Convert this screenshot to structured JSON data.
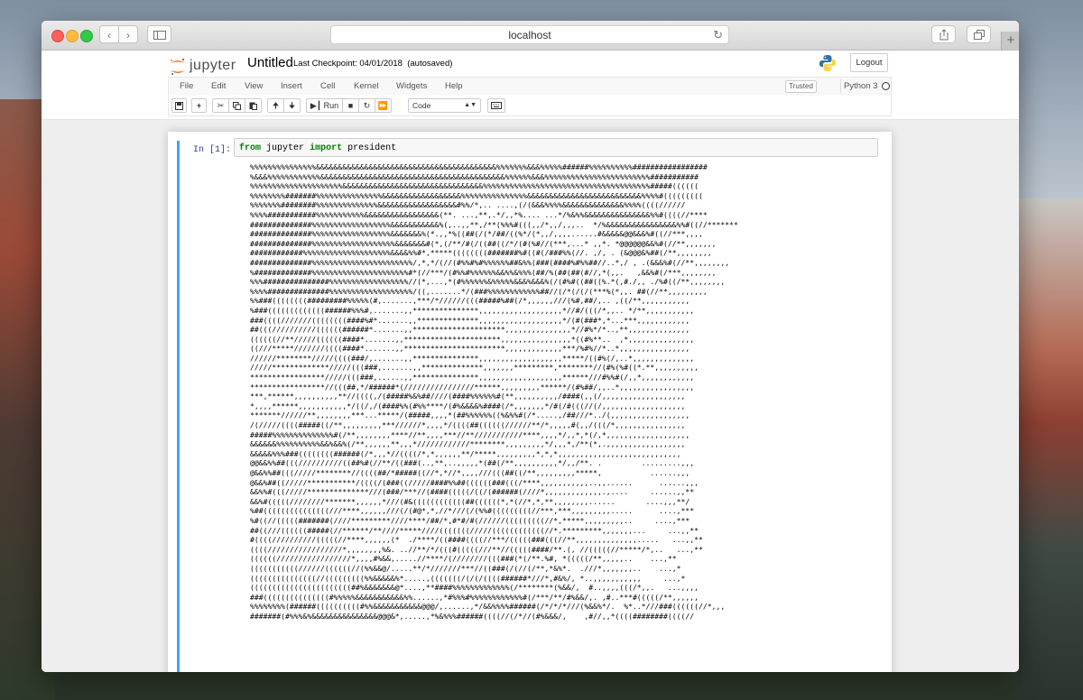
{
  "browser": {
    "url": "localhost"
  },
  "jupyter": {
    "logo_text": "jupyter",
    "notebook_title": "Untitled",
    "checkpoint": "Last Checkpoint: 04/01/2018",
    "autosave_status": "(autosaved)",
    "logout_label": "Logout",
    "menu": [
      "File",
      "Edit",
      "View",
      "Insert",
      "Cell",
      "Kernel",
      "Widgets",
      "Help"
    ],
    "trusted_label": "Trusted",
    "kernel_name": "Python 3",
    "toolbar": {
      "run_label": "Run",
      "cell_type": "Code"
    }
  },
  "cell": {
    "prompt": "In [1]:",
    "code": {
      "kw_from": "from",
      "module": "jupyter",
      "kw_import": "import",
      "name": "president"
    },
    "output_lines": [
      "%%%%%%%%%%%%%%%&&&&&&&&&&&&&&&&&&&&&&&&&&&&&&&&&&&&&&&&&%%%%%%%&&&%%%%%######%%%%%%%%%%#################",
      "%&&&%%%%%%%%%%%%&&&&&&&&&&&&&&&&&&&&&&&&&&&&&&&&&&&&&&&&&&%%%%%%&&&%%%%%%%%%%%%%%%%%%%%%%%%###########",
      "%%%%%%%%%%%%%%%%%%%%%&&&&&&&&&&&&&&&&&&&&&&&&&&&&&&&&%%%%%%%%%%%%%%%%%%%%%%%%%%%%%%%%%%%%%%#####((((((",
      "%%%%%%%%#######%%%%%%%%%%%%%%%&&&&&&&&&&&&&&&&&&%%%%%%%%%%%%%%%&&&&&&&&&&&&&&&&&&&&&&&&&&%%%%#(((((((((",
      "%%%%%%%########%%%%%%%%%%%%%%&&&&&&&&&&&&&&&&&&#%%/*,.. ....,(/(&&&%%%%&&&&&&&&&&&&&&%%%%((((//////",
      "%%%%###########%%%%%%%%%%%&&&&&&&&&&&&&&&&&(**. ...,**,.*/,,*%.... ...*/%&%%&&&&&&&&&&&&&&&%%#((((//****",
      "##############%%%%%%%%%%%%%%%%%%&&&&&&&&&&&%(,..,,**,/**(%%%#(((,,/*,,/,,,..  */%&&&&&&&&&&&&&&&&%%#((//*******",
      "##############%%%%%%%%%%%%%%%%%%&&&&&&&%(*.,,*%((##(/(*/##/((%*/(*,,/,,,,......#&&&&&@@&&&%#((//***,,,,",
      "##############%%%%%%%%%%%%%%%%%%%&&&&&&&#(*,(/**/#(/((##((/*/(#(%#//(***,...* ,,*. *@@@@@@&&%#(//**,,,,,,,",
      "############%%%%%%%%%%%%%%%%%%%%&&&&%%#*,*****((((((((#######%#((#(/###%%(//. ,/, . (&@@@&%##(/**,,,,,,,,",
      "##############%%%%%%%%%%%%%%%%%%%%%%%/,*,*/(//(#%%#%#%%%%%%##&%%(###(####%#%%##//..*,/ , .(&&&%#(//**,,,,,,,,",
      "%#############%%%%%%%%%%%%%%%%%%%%%%#*(//***/(#%%#%%%%%%&&%%&%%%(##/%(##(##(#//,*(,,.   ,&&%#(/***,,,,,,,,",
      "%%%###############%%%%%%%%%%%%%%%%%%//(*,...,*(#%%%%%%&%%%%%&&&%&&&%(/(#%#((##((%.*(,#./,, ./%#((/**,,,,,,,,",
      "%%%%##############%%%%%%%%%%%%%%%%%%%/((,.......*/(###%%%%%%%%%%%%##//(/*(/(/(***%(*,,. ##(//**,,,,,,,,,",
      "%%###((((((((#########%%%%%(#,.......,***/*//////(((#####%##(/*,,,,,,///(%#,##/,.. ,((/**,,,,,,,,,,,",
      "%###(((((((((((((######%%%#,.......,,***************,,,,,,,,,,,,,,,,,,,*//#/(((/*,,.. */**,,,,,,,,,,,",
      "###((((///////((((((((####%#*.......,,**************,,,,,,,,,,,,,,,,,,,*/(#(###*,*...***,,,,,,,,,,,,",
      "##(((//////////((((((######*.......,,*********************,,,,,,,,,,,,,,,*//#%*/*..,**,,,,,,,,,,,,,,",
      "((((((//**/////((((((####*.......,,**********************,,,,,,,,,,,,,,,,*((#%**..  ,*,,,,,,,,,,,,,,,",
      "((///*****///////((((####*.......,,***********************,,,,,,,,,,,,,***/%#%//*..*,,,,,,,,,,,,,,,,",
      "//////********/////((((###/,.......,,***************,,,,,,,,,,,,,,,,,,,*****/((#%(/,..*,,,,,,,,,,,,,,",
      "/////*************/////(((###,.......,,**************,,,,,,,*********,********//(#%(%#((*.**,,,,,,,,,,",
      "*****************/////(((###,......,,***************,,,,,,,,,,,,,,,,,,,******///#%%#(/,,*,,,,,,,,,,,,",
      "*****************//(((##,*/######*(////////////////******,,,,,,,,,******/(#%##/,,..*,,,,,,,,,,,,,,,,,",
      "***,******,,,,,,,,,,**//((((,/(#####%&%##////(####%%%%%%#(**,,,,,,,,,,/####(,,(/,,,,,,,,,,,,,,,,,,,",
      "*,,,,******,,,,,,,,,,,*/((/,/(####%%(#%%****/(#%&&&&%####(/*,,,,,,,*/#(/#(((//(/,,,,,,,,,,,,,,,,,,,",
      "*******//////**,,,,,,,,***...*****/(#####,,,,*(##%%%%%%((%&%%#(/*.....,/##///*../(,,,,,,,,,,,,,,,,,,",
      "/(/////((((#####((/**,,,,,,,,,***//////*,,,,*/((((##((((((//////**/*,,,,,#(,,/(((/*,,,,,,,,,,,,,,,,",
      "#####%%%%%%%%%%%%%%#(/**,,,,,,,,****//**,,,,***//**///////////****,,,,*/,,*,*(/,*,,,,,,,,,,,,,,,,,,,",
      "&&&&&&%%%%%%%%%%&&%&&%(/**,,,,,,**,,,*////////////********,,,,,,,,,*/,,,*,/**(*,.,,,,,,,,,,,,,,,,,,",
      "&&&&&%%%###((((((((######(/*,,,*//((((/*,*,,,,,,**/*****,,,,,,,,,*,*,*,,,,,,,,,,,,,,,,,,,,,,,,,,,,",
      "@@&&%%##(((//////////((##%#(//**/((###(..,**,..,,,,,*(##(/**,,,,,,,,,,*/,,/**. .         .........,,,",
      "@&&%%##(((/////********//((((##/*#####((//*,*//*,,,,///(((##((/**,,,,,,,,,*****,           ......,,,",
      "@&&%##((/////***********/((((/(###((/////####%%##((((((###(((/****,,,,,,,,,,,..,,......      ......,,,",
      "&&%%#(((/////**************///(###/***//(####(((((/((/(######(////*,,,,,,,,,,,,,.,....     ......,,**",
      "&&%#(((((////////*******,,,,,,*///(#&((((((((((((##((((((*,*(//*,*,**,,,,,,,,......       ....,,,**/",
      "%##(((((((((((((((///****,,,,,,///(/(#@*,*,//*///(/(%%#(((((((((//***,***,,,,,,,,,.....      ....,***",
      "%#((//(((((#######(////*********////****/##/*,#*#/#(//////(((((((((//*,*****,,,,,,,,,..     ....,***",
      "##((///((((((#####(//******/**////*****////(((((((/////((((((((((((//*.*********,,,,,,,...     ...,,**",
      "#((((//////////(((((//****,,,,,,(*  ./****/((####((((//***/(((((###(((//**,,,,,,,,,,,,,,.....   ...,,**",
      "((((/////////////////*,,,,,,,,%&. ..//**/*/(((#(((((///**//(((((####/**.(, //(((((//*****/*,..   ...,**",
      "((((((/////////////////*,,,,#%&&,.....//****/(////////(((###(*(/**.%#, *(((((/**,,,,,..    ...,**",
      "(((((((((((//////((((((//(%%&&@/.....**/*///////***//((###(/(//(/**,*&%*.  .///*,,,,,,,..    ...,*",
      "(((((((((((((((//(((((((((%%&&&&&%*.....,(((((((/(/(/((((######*///*,#&%/, *..,,,,,,,,,,,     ...,*",
      "(((((((((((((((((((((((##%&&&&&&&@*....,**####%%%%%%%%%%%%%(/********(%&&/,  #..,,,,(((/*,,.   ...,,,,",
      "###(((((((((((((((#%%%%%&&&&&&&&&&&%%......,*#%%%#%%%%%%%%%%%%#(/***/**/#%&&/,. ,#..***#(((((/**,,,,,,",
      "%%%%%%%%(######((((((((((#%%&&&&&&&&&&&@@@/,......,*/&&%%%%######(/*/*/*///(%&&%*/.  %*..*///###((((((//*,,,",
      "#######(#%%%&%&&&&&&&&&&&&&&&@@@&*,.....,*%&%%%######((((//(/*//(#%&&&/,    ,#//,,*((((########((((//"
    ]
  }
}
